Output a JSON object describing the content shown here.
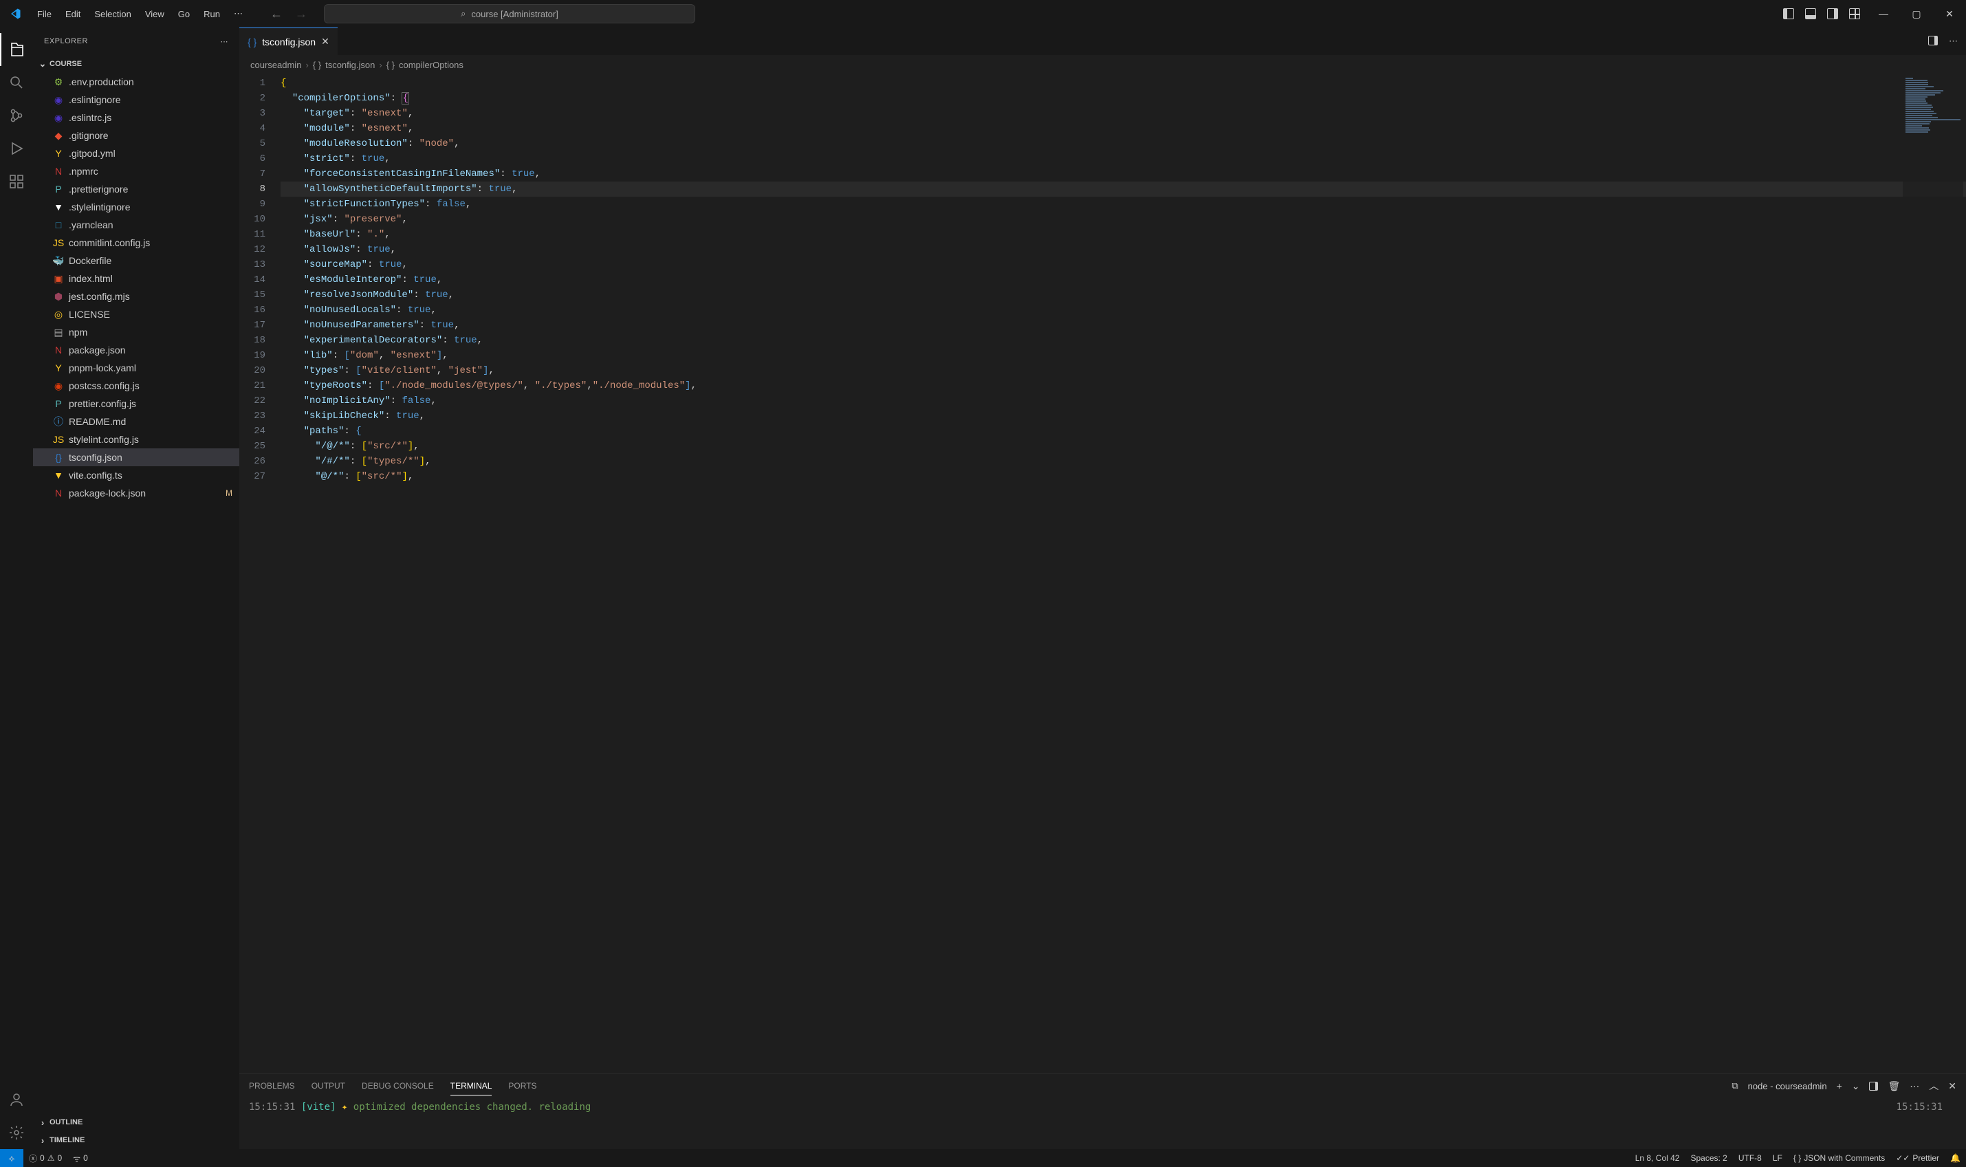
{
  "titleBar": {
    "menus": [
      "File",
      "Edit",
      "Selection",
      "View",
      "Go",
      "Run"
    ],
    "searchText": "course [Administrator]"
  },
  "sidebar": {
    "title": "EXPLORER",
    "sectionTitle": "COURSE",
    "outline": "OUTLINE",
    "timeline": "TIMELINE",
    "files": [
      {
        "name": ".env.production",
        "icon": "⚙",
        "color": "#8dc149"
      },
      {
        "name": ".eslintignore",
        "icon": "◉",
        "color": "#4b32c3"
      },
      {
        "name": ".eslintrc.js",
        "icon": "◉",
        "color": "#4b32c3"
      },
      {
        "name": ".gitignore",
        "icon": "◆",
        "color": "#e84d31"
      },
      {
        "name": ".gitpod.yml",
        "icon": "Y",
        "color": "#ffca28"
      },
      {
        "name": ".npmrc",
        "icon": "N",
        "color": "#cb3837"
      },
      {
        "name": ".prettierignore",
        "icon": "P",
        "color": "#56b3b4"
      },
      {
        "name": ".stylelintignore",
        "icon": "▼",
        "color": "#fff"
      },
      {
        "name": ".yarnclean",
        "icon": "□",
        "color": "#2c8ebb"
      },
      {
        "name": "commitlint.config.js",
        "icon": "JS",
        "color": "#ffca28"
      },
      {
        "name": "Dockerfile",
        "icon": "🐳",
        "color": "#0db7ed"
      },
      {
        "name": "index.html",
        "icon": "▣",
        "color": "#e44d26"
      },
      {
        "name": "jest.config.mjs",
        "icon": "⬢",
        "color": "#99425b"
      },
      {
        "name": "LICENSE",
        "icon": "◎",
        "color": "#ffca28"
      },
      {
        "name": "npm",
        "icon": "▤",
        "color": "#999"
      },
      {
        "name": "package.json",
        "icon": "N",
        "color": "#cb3837"
      },
      {
        "name": "pnpm-lock.yaml",
        "icon": "Y",
        "color": "#ffca28"
      },
      {
        "name": "postcss.config.js",
        "icon": "◉",
        "color": "#dd3a0a"
      },
      {
        "name": "prettier.config.js",
        "icon": "P",
        "color": "#56b3b4"
      },
      {
        "name": "README.md",
        "icon": "ⓘ",
        "color": "#42a5f5"
      },
      {
        "name": "stylelint.config.js",
        "icon": "JS",
        "color": "#ffca28"
      },
      {
        "name": "tsconfig.json",
        "icon": "{}",
        "color": "#3178c6",
        "selected": true
      },
      {
        "name": "vite.config.ts",
        "icon": "▼",
        "color": "#ffca28"
      },
      {
        "name": "package-lock.json",
        "icon": "N",
        "color": "#cb3837",
        "modified": true
      }
    ]
  },
  "tab": {
    "name": "tsconfig.json"
  },
  "breadcrumb": {
    "root": "courseadmin",
    "file": "tsconfig.json",
    "symbol": "compilerOptions"
  },
  "editor": {
    "currentLine": 8,
    "lines": [
      {
        "n": 1,
        "html": "<span class='tok-brace'>{</span>"
      },
      {
        "n": 2,
        "html": "  <span class='tok-key'>\"compilerOptions\"</span><span class='tok-punc'>:</span> <span class='tok-brace2 box-brace'>{</span>"
      },
      {
        "n": 3,
        "html": "    <span class='tok-key'>\"target\"</span><span class='tok-punc'>:</span> <span class='tok-str'>\"esnext\"</span><span class='tok-punc'>,</span>"
      },
      {
        "n": 4,
        "html": "    <span class='tok-key'>\"module\"</span><span class='tok-punc'>:</span> <span class='tok-str'>\"esnext\"</span><span class='tok-punc'>,</span>"
      },
      {
        "n": 5,
        "html": "    <span class='tok-key'>\"moduleResolution\"</span><span class='tok-punc'>:</span> <span class='tok-str'>\"node\"</span><span class='tok-punc'>,</span>"
      },
      {
        "n": 6,
        "html": "    <span class='tok-key'>\"strict\"</span><span class='tok-punc'>:</span> <span class='tok-bool'>true</span><span class='tok-punc'>,</span>"
      },
      {
        "n": 7,
        "html": "    <span class='tok-key'>\"forceConsistentCasingInFileNames\"</span><span class='tok-punc'>:</span> <span class='tok-bool'>true</span><span class='tok-punc'>,</span>"
      },
      {
        "n": 8,
        "html": "    <span class='tok-key'>\"allowSyntheticDefaultImports\"</span><span class='tok-punc'>:</span> <span class='tok-bool'>true</span><span class='tok-punc'>,</span>"
      },
      {
        "n": 9,
        "html": "    <span class='tok-key'>\"strictFunctionTypes\"</span><span class='tok-punc'>:</span> <span class='tok-bool'>false</span><span class='tok-punc'>,</span>"
      },
      {
        "n": 10,
        "html": "    <span class='tok-key'>\"jsx\"</span><span class='tok-punc'>:</span> <span class='tok-str'>\"preserve\"</span><span class='tok-punc'>,</span>"
      },
      {
        "n": 11,
        "html": "    <span class='tok-key'>\"baseUrl\"</span><span class='tok-punc'>:</span> <span class='tok-str'>\".\"</span><span class='tok-punc'>,</span>"
      },
      {
        "n": 12,
        "html": "    <span class='tok-key'>\"allowJs\"</span><span class='tok-punc'>:</span> <span class='tok-bool'>true</span><span class='tok-punc'>,</span>"
      },
      {
        "n": 13,
        "html": "    <span class='tok-key'>\"sourceMap\"</span><span class='tok-punc'>:</span> <span class='tok-bool'>true</span><span class='tok-punc'>,</span>"
      },
      {
        "n": 14,
        "html": "    <span class='tok-key'>\"esModuleInterop\"</span><span class='tok-punc'>:</span> <span class='tok-bool'>true</span><span class='tok-punc'>,</span>"
      },
      {
        "n": 15,
        "html": "    <span class='tok-key'>\"resolveJsonModule\"</span><span class='tok-punc'>:</span> <span class='tok-bool'>true</span><span class='tok-punc'>,</span>"
      },
      {
        "n": 16,
        "html": "    <span class='tok-key'>\"noUnusedLocals\"</span><span class='tok-punc'>:</span> <span class='tok-bool'>true</span><span class='tok-punc'>,</span>"
      },
      {
        "n": 17,
        "html": "    <span class='tok-key'>\"noUnusedParameters\"</span><span class='tok-punc'>:</span> <span class='tok-bool'>true</span><span class='tok-punc'>,</span>"
      },
      {
        "n": 18,
        "html": "    <span class='tok-key'>\"experimentalDecorators\"</span><span class='tok-punc'>:</span> <span class='tok-bool'>true</span><span class='tok-punc'>,</span>"
      },
      {
        "n": 19,
        "html": "    <span class='tok-key'>\"lib\"</span><span class='tok-punc'>:</span> <span class='tok-bracket'>[</span><span class='tok-str'>\"dom\"</span><span class='tok-punc'>,</span> <span class='tok-str'>\"esnext\"</span><span class='tok-bracket'>]</span><span class='tok-punc'>,</span>"
      },
      {
        "n": 20,
        "html": "    <span class='tok-key'>\"types\"</span><span class='tok-punc'>:</span> <span class='tok-bracket'>[</span><span class='tok-str'>\"vite/client\"</span><span class='tok-punc'>,</span> <span class='tok-str'>\"jest\"</span><span class='tok-bracket'>]</span><span class='tok-punc'>,</span>"
      },
      {
        "n": 21,
        "html": "    <span class='tok-key'>\"typeRoots\"</span><span class='tok-punc'>:</span> <span class='tok-bracket'>[</span><span class='tok-str'>\"./node_modules/@types/\"</span><span class='tok-punc'>,</span> <span class='tok-str'>\"./types\"</span><span class='tok-punc'>,</span><span class='tok-str'>\"./node_modules\"</span><span class='tok-bracket'>]</span><span class='tok-punc'>,</span>"
      },
      {
        "n": 22,
        "html": "    <span class='tok-key'>\"noImplicitAny\"</span><span class='tok-punc'>:</span> <span class='tok-bool'>false</span><span class='tok-punc'>,</span>"
      },
      {
        "n": 23,
        "html": "    <span class='tok-key'>\"skipLibCheck\"</span><span class='tok-punc'>:</span> <span class='tok-bool'>true</span><span class='tok-punc'>,</span>"
      },
      {
        "n": 24,
        "html": "    <span class='tok-key'>\"paths\"</span><span class='tok-punc'>:</span> <span class='tok-bracket'>{</span>"
      },
      {
        "n": 25,
        "html": "      <span class='tok-key'>\"/@/*\"</span><span class='tok-punc'>:</span> <span class='tok-brace'>[</span><span class='tok-str'>\"src/*\"</span><span class='tok-brace'>]</span><span class='tok-punc'>,</span>"
      },
      {
        "n": 26,
        "html": "      <span class='tok-key'>\"/#/*\"</span><span class='tok-punc'>:</span> <span class='tok-brace'>[</span><span class='tok-str'>\"types/*\"</span><span class='tok-brace'>]</span><span class='tok-punc'>,</span>"
      },
      {
        "n": 27,
        "html": "      <span class='tok-key'>\"@/*\"</span><span class='tok-punc'>:</span> <span class='tok-brace'>[</span><span class='tok-str'>\"src/*\"</span><span class='tok-brace'>]</span><span class='tok-punc'>,</span>"
      }
    ]
  },
  "panel": {
    "tabs": [
      "PROBLEMS",
      "OUTPUT",
      "DEBUG CONSOLE",
      "TERMINAL",
      "PORTS"
    ],
    "activeTab": "TERMINAL",
    "terminalTitle": "node - courseadmin",
    "time": "15:15:31",
    "vite": "[vite]",
    "spark": "✦",
    "msg": "optimized dependencies changed. reloading",
    "timeRight": "15:15:31"
  },
  "status": {
    "errors": "0",
    "warnings": "0",
    "ports": "0",
    "pos": "Ln 8, Col 42",
    "spaces": "Spaces: 2",
    "encoding": "UTF-8",
    "eol": "LF",
    "lang": "JSON with Comments",
    "prettier": "Prettier"
  }
}
